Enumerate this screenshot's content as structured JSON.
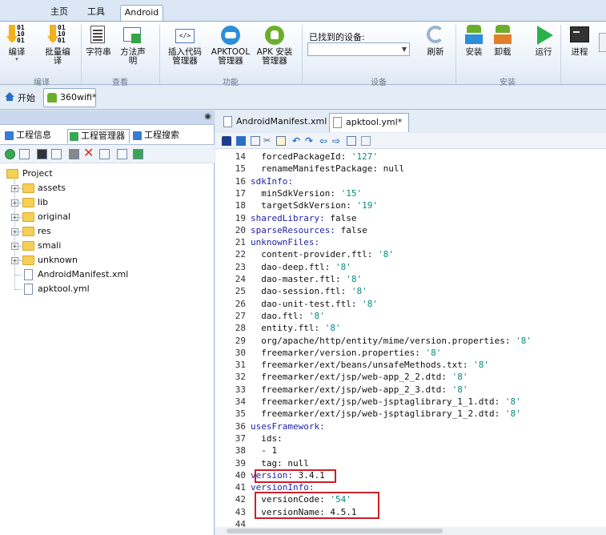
{
  "menubar": {
    "tabs": [
      "主页",
      "工具",
      "Android"
    ],
    "active": "Android"
  },
  "ribbon": {
    "groups": [
      "编译",
      "查看",
      "功能",
      "设备",
      "安装"
    ],
    "buttons": {
      "compile": "编译",
      "batch_compile_1": "批量编",
      "batch_compile_2": "译",
      "strings": "字符串",
      "method_decl_1": "方法声",
      "method_decl_2": "明",
      "insert_code_1": "插入代码",
      "insert_code_2": "管理器",
      "apktool_1": "APKTOOL",
      "apktool_2": "管理器",
      "apk_install_1": "APK 安装",
      "apk_install_2": "管理器",
      "refresh": "刷新",
      "install": "安装",
      "uninstall": "卸载",
      "run": "运行",
      "process": "进程"
    },
    "device_label": "已找到的设备:",
    "device_value": ""
  },
  "docstrip": {
    "start": "开始",
    "project_tab": "360wifi*"
  },
  "left_panel": {
    "tabs": [
      "工程信息",
      "工程管理器",
      "工程搜索"
    ],
    "active_tab": "工程管理器",
    "tree": {
      "root": "Project",
      "folders": [
        "assets",
        "lib",
        "original",
        "res",
        "smali",
        "unknown"
      ],
      "files": [
        "AndroidManifest.xml",
        "apktool.yml"
      ]
    }
  },
  "editor": {
    "tabs": [
      "AndroidManifest.xml",
      "apktool.yml*"
    ],
    "active_tab": "apktool.yml*",
    "lines": [
      {
        "n": "14",
        "k": "  forcedPackageId:",
        "v": " '127'"
      },
      {
        "n": "15",
        "k": "  renameManifestPackage:",
        "v": " null"
      },
      {
        "n": "16",
        "k": "sdkInfo:",
        "v": ""
      },
      {
        "n": "17",
        "k": "  minSdkVersion:",
        "v": " '15'"
      },
      {
        "n": "18",
        "k": "  targetSdkVersion:",
        "v": " '19'"
      },
      {
        "n": "19",
        "k": "sharedLibrary:",
        "v": " false"
      },
      {
        "n": "20",
        "k": "sparseResources:",
        "v": " false"
      },
      {
        "n": "21",
        "k": "unknownFiles:",
        "v": ""
      },
      {
        "n": "22",
        "k": "  content-provider.ftl:",
        "v": " '8'"
      },
      {
        "n": "23",
        "k": "  dao-deep.ftl:",
        "v": " '8'"
      },
      {
        "n": "24",
        "k": "  dao-master.ftl:",
        "v": " '8'"
      },
      {
        "n": "25",
        "k": "  dao-session.ftl:",
        "v": " '8'"
      },
      {
        "n": "26",
        "k": "  dao-unit-test.ftl:",
        "v": " '8'"
      },
      {
        "n": "27",
        "k": "  dao.ftl:",
        "v": " '8'"
      },
      {
        "n": "28",
        "k": "  entity.ftl:",
        "v": " '8'"
      },
      {
        "n": "29",
        "k": "  org/apache/http/entity/mime/version.properties:",
        "v": " '8'"
      },
      {
        "n": "30",
        "k": "  freemarker/version.properties:",
        "v": " '8'"
      },
      {
        "n": "31",
        "k": "  freemarker/ext/beans/unsafeMethods.txt:",
        "v": " '8'"
      },
      {
        "n": "32",
        "k": "  freemarker/ext/jsp/web-app_2_2.dtd:",
        "v": " '8'"
      },
      {
        "n": "33",
        "k": "  freemarker/ext/jsp/web-app_2_3.dtd:",
        "v": " '8'"
      },
      {
        "n": "34",
        "k": "  freemarker/ext/jsp/web-jsptaglibrary_1_1.dtd:",
        "v": " '8'"
      },
      {
        "n": "35",
        "k": "  freemarker/ext/jsp/web-jsptaglibrary_1_2.dtd:",
        "v": " '8'"
      },
      {
        "n": "36",
        "k": "usesFramework:",
        "v": ""
      },
      {
        "n": "37",
        "k": "  ids:",
        "v": ""
      },
      {
        "n": "38",
        "k": "  - 1",
        "v": ""
      },
      {
        "n": "39",
        "k": "  tag:",
        "v": " null"
      },
      {
        "n": "40",
        "k": "version:",
        "v": " 3.4.1"
      },
      {
        "n": "41",
        "k": "versionInfo:",
        "v": ""
      },
      {
        "n": "42",
        "k": "  versionCode:",
        "v": " '54'"
      },
      {
        "n": "43",
        "k": "  versionName:",
        "v": " 4.5.1"
      },
      {
        "n": "44",
        "k": "",
        "v": ""
      }
    ]
  },
  "colors": {
    "highlight_box": "#c8202a",
    "key": "#1f1fa8",
    "string": "#0a8a7a",
    "run_green": "#2bb24c"
  }
}
